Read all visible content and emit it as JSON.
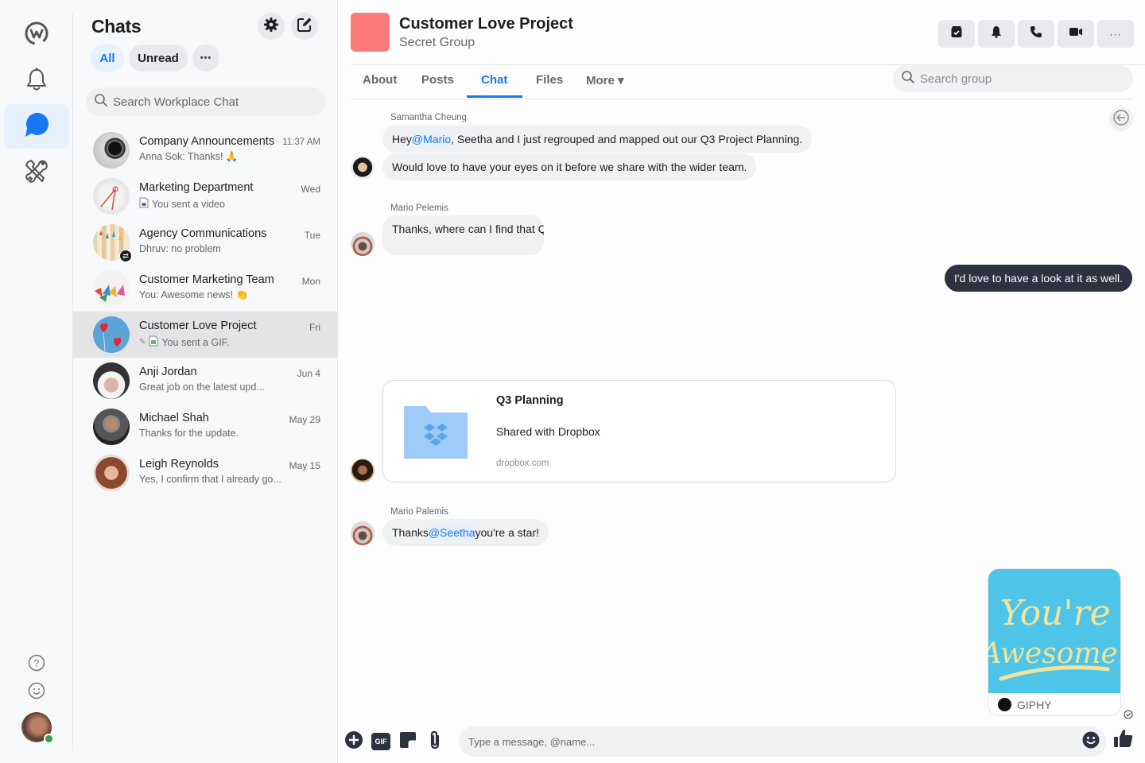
{
  "rail": {
    "items": [
      {
        "name": "workplace-logo",
        "icon": "workplace-icon"
      },
      {
        "name": "notifications",
        "icon": "bell-icon"
      },
      {
        "name": "chats",
        "icon": "chat-bubble-icon",
        "active": true
      },
      {
        "name": "integrations",
        "icon": "tools-icon"
      }
    ],
    "bottom": [
      {
        "name": "help",
        "icon": "help-icon"
      },
      {
        "name": "feedback",
        "icon": "smiley-icon"
      }
    ],
    "status_color": "#31a24c"
  },
  "chat_list": {
    "title": "Chats",
    "filters": [
      {
        "label": "All",
        "active": true
      },
      {
        "label": "Unread",
        "active": false
      },
      {
        "label": "•••"
      }
    ],
    "search_placeholder": "Search Workplace Chat",
    "items": [
      {
        "name": "Company Announcements",
        "preview": "Anna Sok: Thanks! 🙏",
        "time": "11:37 AM"
      },
      {
        "name": "Marketing Department",
        "preview": "You sent a video",
        "time": "Wed",
        "preview_icon": "video-file-icon"
      },
      {
        "name": "Agency Communications",
        "preview": "Dhruv: no problem",
        "time": "Tue",
        "badge": "⇄"
      },
      {
        "name": "Customer Marketing Team",
        "preview": "You: Awesome news! 👏",
        "time": "Mon"
      },
      {
        "name": "Customer Love Project",
        "preview": "You sent a GIF.",
        "time": "Fri",
        "selected": true,
        "preview_icon": "gif-file-icon"
      },
      {
        "name": "Anji Jordan",
        "preview": "Great job on the latest upd...",
        "time": "Jun 4"
      },
      {
        "name": "Michael Shah",
        "preview": "Thanks for the update.",
        "time": "May 29"
      },
      {
        "name": "Leigh Reynolds",
        "preview": "Yes, I confirm that I already go...",
        "time": "May 15"
      }
    ]
  },
  "header": {
    "title": "Customer Love Project",
    "subtitle": "Secret Group",
    "thumb_color": "#fd7b77",
    "actions": [
      "inbox-check-icon",
      "bell-icon",
      "phone-icon",
      "video-icon",
      "more-icon"
    ],
    "more_label": "···",
    "tabs": [
      {
        "label": "About"
      },
      {
        "label": "Posts"
      },
      {
        "label": "Chat",
        "active": true
      },
      {
        "label": "Files"
      },
      {
        "label": "More ▾"
      }
    ],
    "search_placeholder": "Search group",
    "accent": "#1877f2"
  },
  "messages": {
    "m1": {
      "sender": "Samantha Cheung",
      "line1_pre": "Hey ",
      "line1_mention": "@Mario",
      "line1_post": ", Seetha and I just regrouped and mapped out our Q3 Project Planning.",
      "line2": "Would love to have your eyes on it before we share with the wider team."
    },
    "m2": {
      "sender": "Mario Pelemis",
      "text": "Thanks, where can I find that Q"
    },
    "m3": {
      "text": "I'd love to have a look at it as well."
    },
    "share": {
      "title": "Q3 Planning",
      "subtitle": "Shared with Dropbox",
      "link": "dropbox.com"
    },
    "m4": {
      "sender": "Mario Palemis",
      "pre": "Thanks ",
      "mention": "@Seetha",
      "post": " you're a star!"
    },
    "gif": {
      "text_line1": "You're",
      "text_line2": "Awesome!",
      "source": "GIPHY"
    }
  },
  "composer": {
    "placeholder": "Type a message, @name...",
    "gif_label": "GIF",
    "tools": [
      "add-icon",
      "gif-icon",
      "sticker-icon",
      "attach-icon"
    ],
    "right": [
      "emoji-icon",
      "like-icon"
    ]
  }
}
